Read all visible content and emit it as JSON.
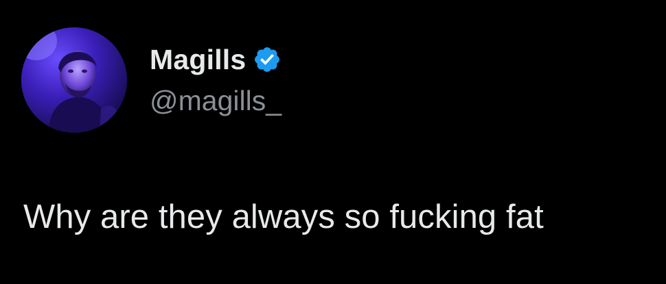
{
  "tweet": {
    "author": {
      "display_name": "Magills",
      "handle": "@magills_",
      "verified": true,
      "avatar_icon": "user-avatar-photo",
      "verified_icon": "verified-badge-icon"
    },
    "text": "Why are they always so fucking fat"
  },
  "colors": {
    "background": "#000000",
    "primary_text": "#e7e9ea",
    "secondary_text": "#8b9096",
    "verified_blue": "#1d9bf0"
  }
}
